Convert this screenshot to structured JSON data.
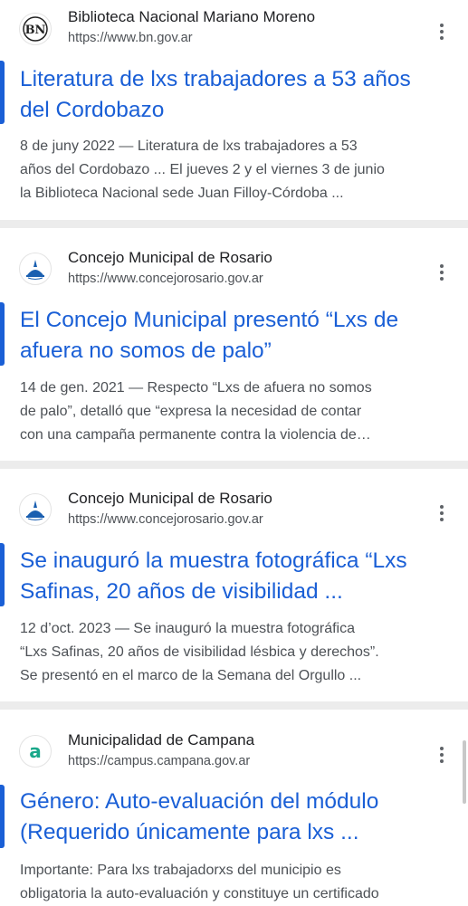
{
  "results": [
    {
      "site": "Biblioteca Nacional Mariano Moreno",
      "url": "https://www.bn.gov.ar",
      "favicon_letters": "BN",
      "title_lines": [
        "Literatura de lxs trabajadores a 53 años",
        "del Cordobazo"
      ],
      "snippet_lines": [
        "8 de juny 2022 — Literatura de lxs trabajadores a 53",
        "años del Cordobazo ... El jueves 2 y el viernes 3 de junio",
        "la Biblioteca Nacional sede Juan Filloy-Córdoba ..."
      ]
    },
    {
      "site": "Concejo Municipal de Rosario",
      "url": "https://www.concejorosario.gov.ar",
      "title_lines": [
        "El Concejo Municipal presentó “Lxs de",
        "afuera no somos de palo”"
      ],
      "snippet_lines": [
        "14 de gen. 2021 — Respecto “Lxs de afuera no somos",
        "de palo”, detalló que “expresa la necesidad de contar",
        "con una campaña permanente contra la violencia de…"
      ]
    },
    {
      "site": "Concejo Municipal de Rosario",
      "url": "https://www.concejorosario.gov.ar",
      "title_lines": [
        "Se inauguró la muestra fotográfica “Lxs",
        "Safinas, 20 años de visibilidad ..."
      ],
      "snippet_lines": [
        "12 d’oct. 2023 — Se inauguró la muestra fotográfica",
        "“Lxs Safinas, 20 años de visibilidad lésbica y derechos”.",
        "Se presentó en el marco de la Semana del Orgullo ..."
      ]
    },
    {
      "site": "Municipalidad de Campana",
      "url": "https://campus.campana.gov.ar",
      "favicon_letter": "a",
      "title_lines": [
        "Género: Auto-evaluación del módulo",
        "(Requerido únicamente para lxs ..."
      ],
      "snippet_lines": [
        "Importante: Para lxs trabajadorxs del municipio es",
        "obligatoria la auto-evaluación y constituye un certificado"
      ]
    }
  ],
  "colors": {
    "link": "#1a5fd6",
    "snippet": "#4d5156",
    "separator": "#ececec",
    "campana_green": "#1aa88a"
  }
}
